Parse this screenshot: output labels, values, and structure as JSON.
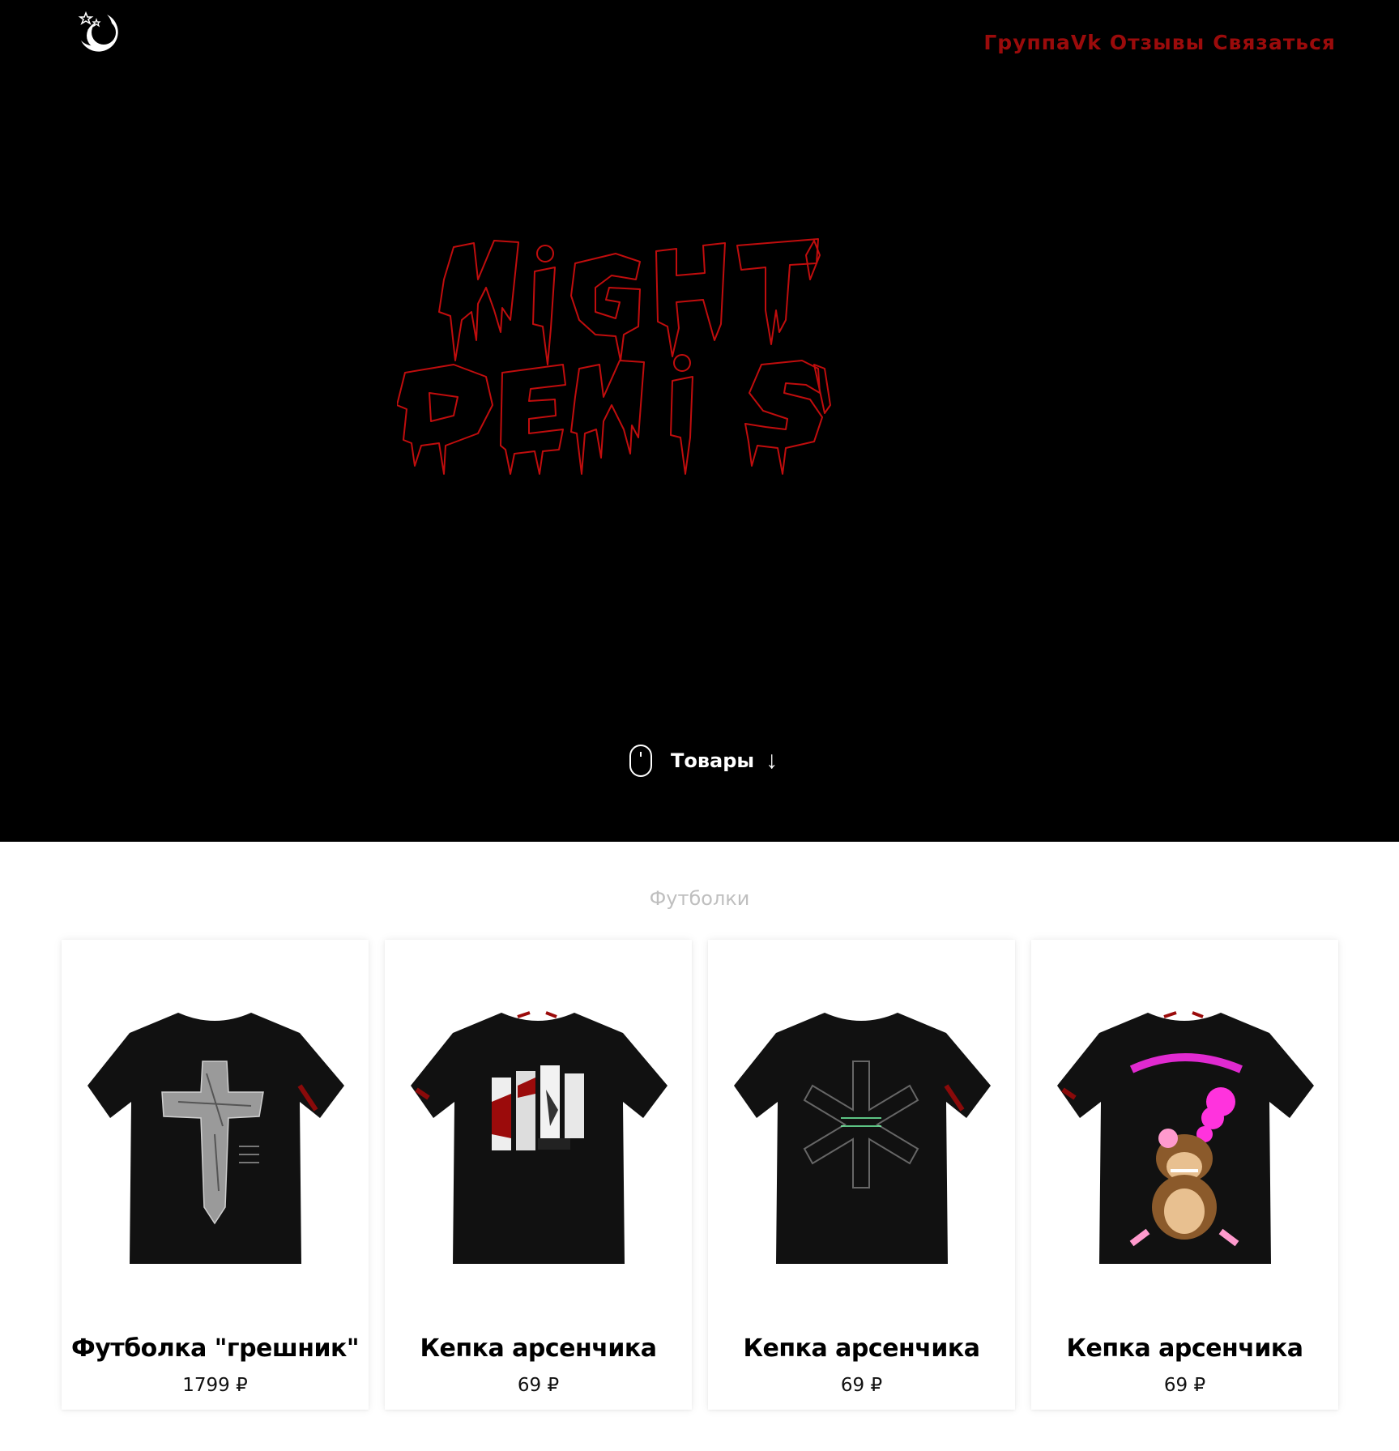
{
  "header": {
    "logo_icon": "moon-stars-logo",
    "nav": [
      "ГруппаVk",
      "Отзывы",
      "Связаться"
    ]
  },
  "hero": {
    "brand_text": "NIGHT DENIS",
    "cta_label": "Товары",
    "cta_arrow": "↓",
    "accent_color": "#9b0b0b"
  },
  "catalog": {
    "section_title": "Футболки",
    "products": [
      {
        "name": "Футболка \"грешник\"",
        "price": "1799 ₽",
        "image_icon": "cross-tshirt"
      },
      {
        "name": "Кепка арсенчика",
        "price": "69 ₽",
        "image_icon": "praying-hands-tshirt"
      },
      {
        "name": "Кепка арсенчика",
        "price": "69 ₽",
        "image_icon": "asterisk-tshirt"
      },
      {
        "name": "Кепка арсенчика",
        "price": "69 ₽",
        "image_icon": "smoke-clinic-monkey-tshirt"
      }
    ]
  }
}
